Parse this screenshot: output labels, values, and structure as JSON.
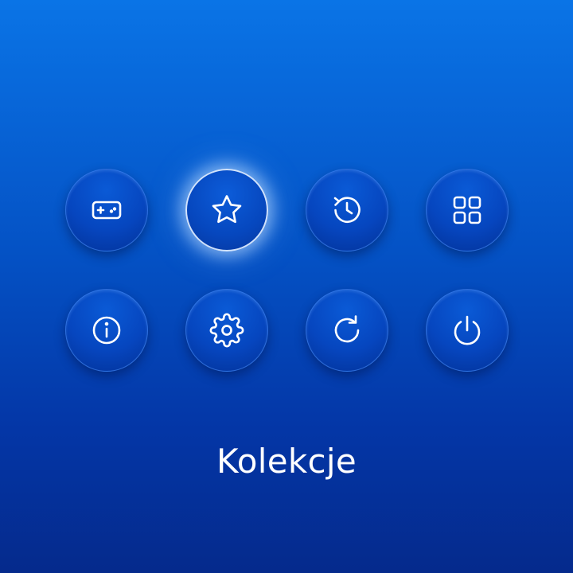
{
  "colors": {
    "background_top": "#0A74E6",
    "background_bottom": "#052A8C",
    "button_fill": "#0646BF",
    "icon_stroke": "#FFFFFF",
    "selection_glow": "#BEDCFF"
  },
  "menu": {
    "selected_index": 1,
    "items": [
      {
        "icon": "gamepad-icon"
      },
      {
        "icon": "star-icon"
      },
      {
        "icon": "history-icon"
      },
      {
        "icon": "grid-icon"
      },
      {
        "icon": "info-icon"
      },
      {
        "icon": "gear-icon"
      },
      {
        "icon": "refresh-icon"
      },
      {
        "icon": "power-icon"
      }
    ]
  },
  "selected_label": "Kolekcje"
}
